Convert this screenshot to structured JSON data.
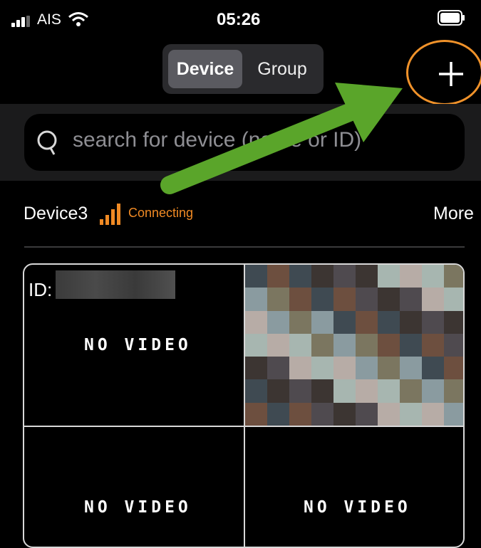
{
  "status_bar": {
    "carrier": "AIS",
    "time": "05:26",
    "signal_icon": "signal-bars-icon",
    "wifi_icon": "wifi-icon",
    "battery_icon": "battery-icon"
  },
  "header": {
    "tabs": [
      {
        "label": "Device",
        "selected": true
      },
      {
        "label": "Group",
        "selected": false
      }
    ],
    "add_icon": "plus-icon",
    "highlight_color": "#f0922a"
  },
  "search": {
    "placeholder": "search for device (name or ID)",
    "icon": "search-icon"
  },
  "annotation": {
    "arrow_color": "#5aa52a",
    "arrow_icon": "arrow-icon"
  },
  "device": {
    "name": "Device3",
    "status": "Connecting",
    "status_color": "#f08a24",
    "more_label": "More",
    "id_label": "ID:"
  },
  "channels": [
    {
      "label": "NO VIDEO"
    },
    {
      "label": "NO VIDEO"
    },
    {
      "label": "NO VIDEO"
    }
  ]
}
